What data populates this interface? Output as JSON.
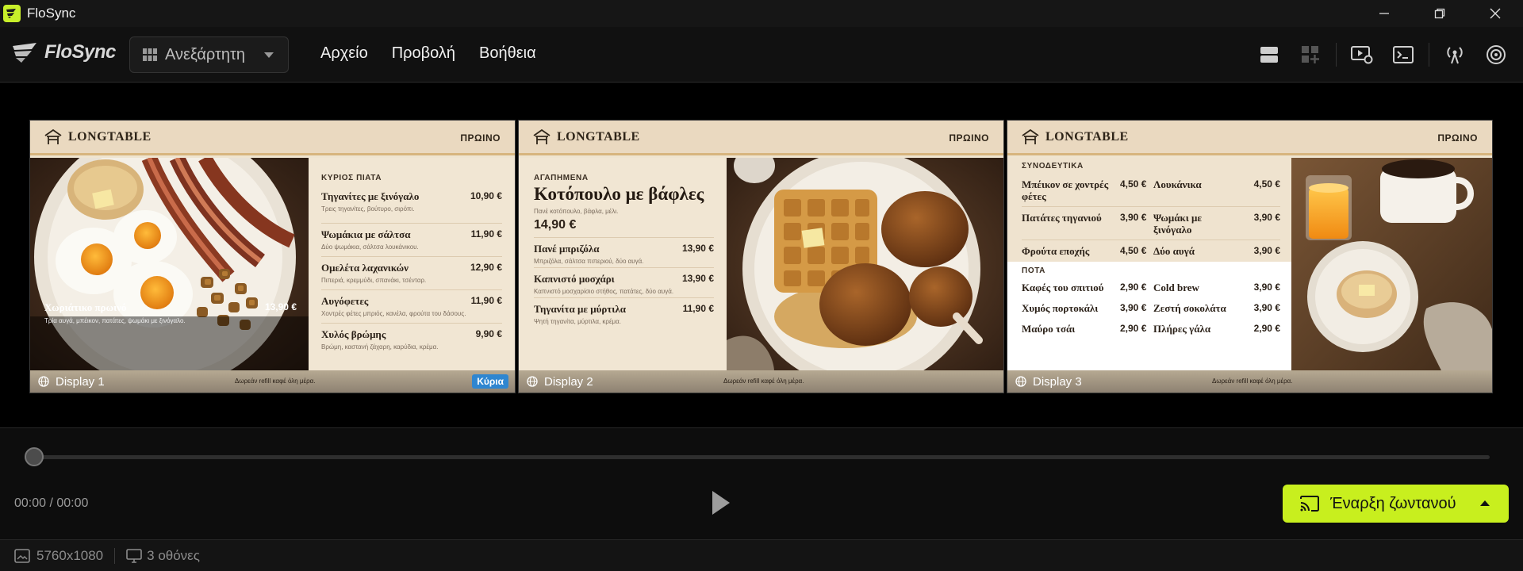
{
  "window": {
    "title": "FloSync"
  },
  "menubar": {
    "logo": "FloSync",
    "mode_label": "Ανεξάρτητη",
    "menus": [
      "Αρχείο",
      "Προβολή",
      "Βοήθεια"
    ]
  },
  "displays": [
    {
      "name": "Display 1",
      "brand": "LONGTABLE",
      "meal": "ΠΡΩΙΝΟ",
      "footer_note": "Δωρεάν refill καφέ όλη μέρα.",
      "badge": "Κύρια",
      "hero": {
        "name": "Χωριάτικο πρωινό",
        "desc": "Τρία αυγά, μπέικον, πατάτες, ψωμάκι με ξινόγαλο.",
        "price": "13,90 €"
      },
      "section": "ΚΥΡΙΟΣ ΠΙΑΤΑ",
      "items": [
        {
          "name": "Τηγανίτες με ξινόγαλο",
          "desc": "Τρεις τηγανίτες, βούτυρο, σιρόπι.",
          "price": "10,90 €"
        },
        {
          "name": "Ψωμάκια με σάλτσα",
          "desc": "Δύο ψωμάκια, σάλτσα λουκάνικου.",
          "price": "11,90 €"
        },
        {
          "name": "Ομελέτα λαχανικών",
          "desc": "Πιπεριά, κρεμμύδι, σπανάκι, τσένταρ.",
          "price": "12,90 €"
        },
        {
          "name": "Αυγόφετες",
          "desc": "Χοντρές φέτες μπριός, κανέλα, φρούτα του δάσους.",
          "price": "11,90 €"
        },
        {
          "name": "Χυλός βρώμης",
          "desc": "Βρώμη, καστανή ζάχαρη, καρύδια, κρέμα.",
          "price": "9,90 €"
        }
      ]
    },
    {
      "name": "Display 2",
      "brand": "LONGTABLE",
      "meal": "ΠΡΩΙΝΟ",
      "footer_note": "Δωρεάν refill καφέ όλη μέρα.",
      "section": "ΑΓΑΠΗΜΕΝΑ",
      "feature": {
        "name": "Κοτόπουλο με βάφλες",
        "desc": "Πανέ κοτόπουλο, βάφλα, μέλι.",
        "price": "14,90 €"
      },
      "items": [
        {
          "name": "Πανέ μπριζόλα",
          "desc": "Μπριζόλα, σάλτσα πιπεριού, δύο αυγά.",
          "price": "13,90 €"
        },
        {
          "name": "Καπνιστό μοσχάρι",
          "desc": "Καπνιστό μοσχαρίσιο στήθος, πατάτες, δύο αυγά.",
          "price": "13,90 €"
        },
        {
          "name": "Τηγανίτα με μύρτιλα",
          "desc": "Ψητή τηγανίτα, μύρτιλα, κρέμα.",
          "price": "11,90 €"
        }
      ]
    },
    {
      "name": "Display 3",
      "brand": "LONGTABLE",
      "meal": "ΠΡΩΙΝΟ",
      "footer_note": "Δωρεάν refill καφέ όλη μέρα.",
      "sides_title": "ΣΥΝΟΔΕΥΤΙΚΑ",
      "sides": [
        {
          "a": "Μπέικον σε χοντρές φέτες",
          "ap": "4,50 €",
          "b": "Λουκάνικα",
          "bp": "4,50 €"
        },
        {
          "a": "Πατάτες τηγανιού",
          "ap": "3,90 €",
          "b": "Ψωμάκι με ξινόγαλο",
          "bp": "3,90 €"
        },
        {
          "a": "Φρούτα εποχής",
          "ap": "4,50 €",
          "b": "Δύο αυγά",
          "bp": "3,90 €"
        }
      ],
      "drinks_title": "ΠΟΤΑ",
      "drinks": [
        {
          "a": "Καφές του σπιτιού",
          "ap": "2,90 €",
          "b": "Cold brew",
          "bp": "3,90 €"
        },
        {
          "a": "Χυμός πορτοκάλι",
          "ap": "3,90 €",
          "b": "Ζεστή σοκολάτα",
          "bp": "3,90 €"
        },
        {
          "a": "Μαύρο τσάι",
          "ap": "2,90 €",
          "b": "Πλήρες γάλα",
          "bp": "2,90 €"
        }
      ]
    }
  ],
  "playback": {
    "time": "00:00 / 00:00",
    "progress": 0,
    "live_label": "Έναρξη ζωντανού"
  },
  "status": {
    "resolution": "5760x1080",
    "screens": "3 οθόνες"
  },
  "colors": {
    "accent": "#c8ef1e",
    "badge": "#2f86d0"
  }
}
